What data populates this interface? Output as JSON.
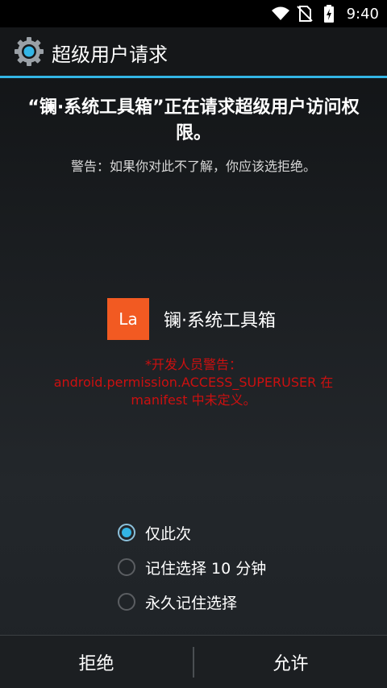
{
  "status_bar": {
    "time": "9:40",
    "icons": [
      "wifi-icon",
      "no-sim-icon",
      "battery-charging-icon"
    ]
  },
  "action_bar": {
    "icon": "gear-icon",
    "title": "超级用户请求"
  },
  "request": {
    "headline": "“镧·系统工具箱”正在请求超级用户访问权限。",
    "warning": "警告：如果你对此不了解，你应该选拒绝。"
  },
  "app": {
    "icon_text": "La",
    "icon_color": "#f25a22",
    "name": "镧·系统工具箱"
  },
  "developer_warning": "*开发人员警告：android.permission.ACCESS_SUPERUSER 在 manifest 中未定义。",
  "duration_options": [
    {
      "label": "仅此次",
      "selected": true
    },
    {
      "label": "记住选择 10 分钟",
      "selected": false
    },
    {
      "label": "永久记住选择",
      "selected": false
    }
  ],
  "buttons": {
    "deny": "拒绝",
    "allow": "允许"
  },
  "colors": {
    "accent": "#33b5e5",
    "warning_red": "#cc1010"
  }
}
